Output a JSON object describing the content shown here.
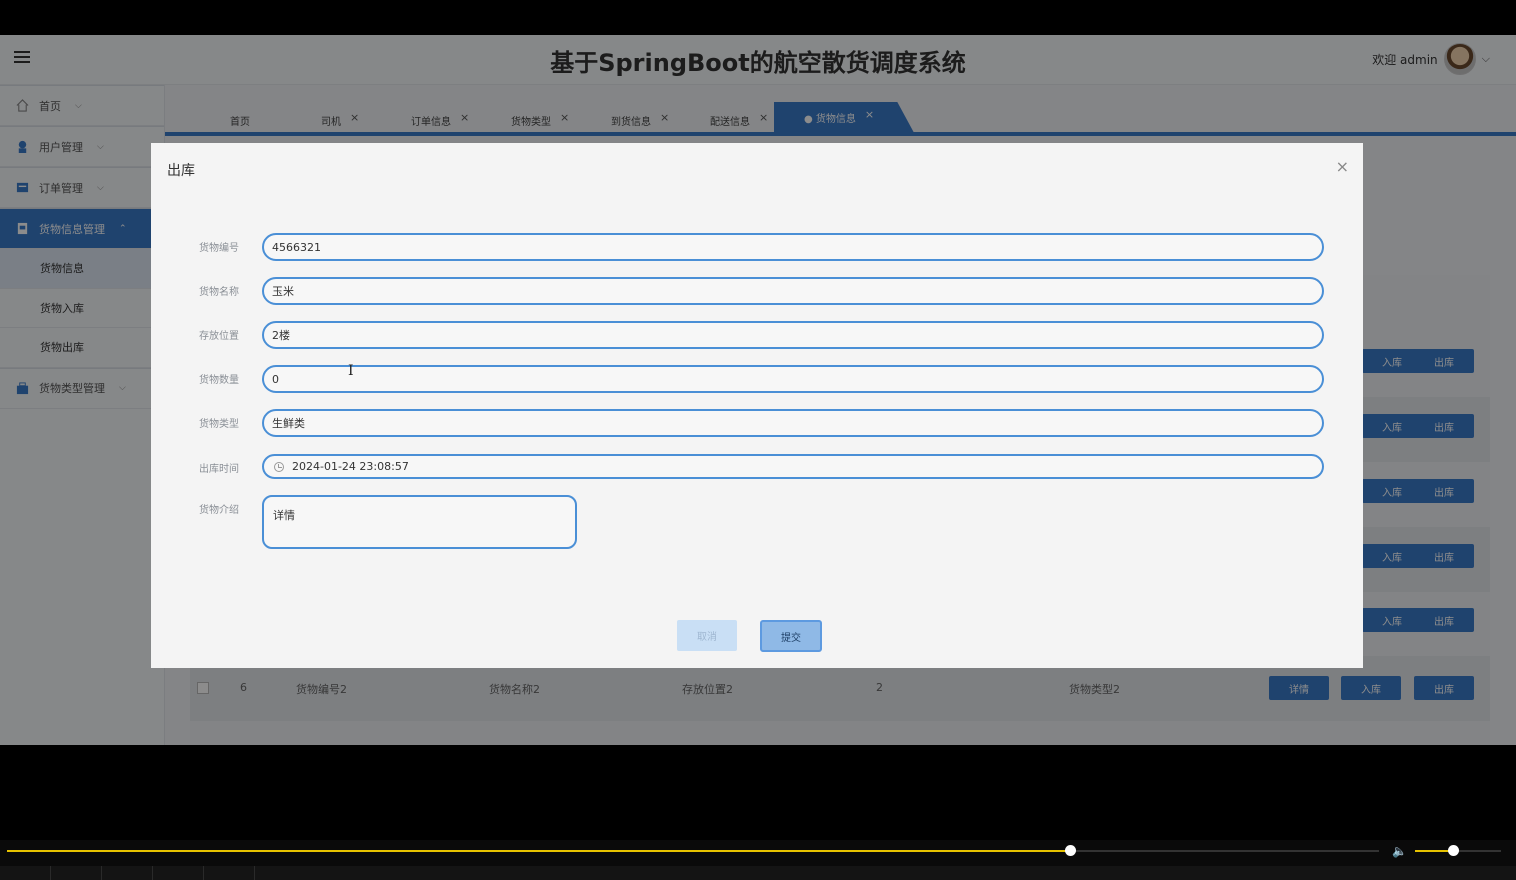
{
  "header": {
    "title": "基于SpringBoot的航空散货调度系统",
    "welcome": "欢迎 admin"
  },
  "sidebar": {
    "items": [
      {
        "label": "首页",
        "icon": "home-icon"
      },
      {
        "label": "用户管理",
        "icon": "user-icon"
      },
      {
        "label": "订单管理",
        "icon": "order-icon"
      },
      {
        "label": "货物信息管理",
        "icon": "cargo-icon",
        "active": true,
        "children": [
          "货物信息",
          "货物入库",
          "货物出库"
        ]
      },
      {
        "label": "货物类型管理",
        "icon": "category-icon"
      }
    ]
  },
  "tabs": [
    {
      "label": "首页",
      "closable": false
    },
    {
      "label": "司机",
      "closable": true
    },
    {
      "label": "订单信息",
      "closable": true
    },
    {
      "label": "货物类型",
      "closable": true
    },
    {
      "label": "到货信息",
      "closable": true
    },
    {
      "label": "配送信息",
      "closable": true
    },
    {
      "label": "● 货物信息",
      "closable": true,
      "active": true
    }
  ],
  "background_table": {
    "visible_row": {
      "index": "6",
      "code": "货物编号2",
      "name": "货物名称2",
      "location": "存放位置2",
      "qty": "2",
      "type": "货物类型2"
    },
    "buttons": {
      "detail": "详情",
      "in": "入库",
      "out": "出库"
    }
  },
  "modal": {
    "title": "出库",
    "close": "×",
    "fields": {
      "code": {
        "label": "货物编号",
        "value": "4566321"
      },
      "name": {
        "label": "货物名称",
        "value": "玉米"
      },
      "location": {
        "label": "存放位置",
        "value": "2楼"
      },
      "quantity": {
        "label": "货物数量",
        "value": "0"
      },
      "type": {
        "label": "货物类型",
        "value": "生鲜类"
      },
      "out_time": {
        "label": "出库时间",
        "value": "2024-01-24 23:08:57"
      },
      "intro": {
        "label": "货物介绍",
        "value": "详情"
      }
    },
    "cancel_label": "取消",
    "submit_label": "提交"
  },
  "player": {
    "progress": 0.775,
    "volume": 0.44,
    "accent": "#e6c200"
  },
  "colors": {
    "primary": "#3a7ac9",
    "input_border": "#4a8fd6"
  }
}
